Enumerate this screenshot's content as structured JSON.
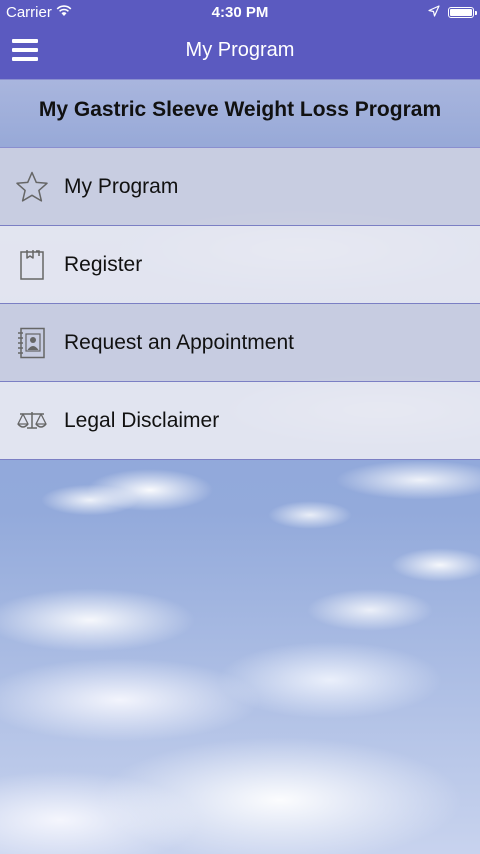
{
  "status_bar": {
    "carrier": "Carrier",
    "time": "4:30 PM",
    "icons": [
      "wifi-icon",
      "location-icon",
      "battery-icon"
    ]
  },
  "nav_bar": {
    "title": "My Program",
    "menu_icon": "hamburger-menu-icon",
    "background_color": "#5b5ac0"
  },
  "program_header": {
    "title": "My Gastric Sleeve Weight Loss Program"
  },
  "menu": {
    "items": [
      {
        "label": "My Program",
        "icon": "star-icon"
      },
      {
        "label": "Register",
        "icon": "clipboard-icon"
      },
      {
        "label": "Request an Appointment",
        "icon": "contact-book-icon"
      },
      {
        "label": "Legal Disclaimer",
        "icon": "scales-icon"
      }
    ]
  }
}
